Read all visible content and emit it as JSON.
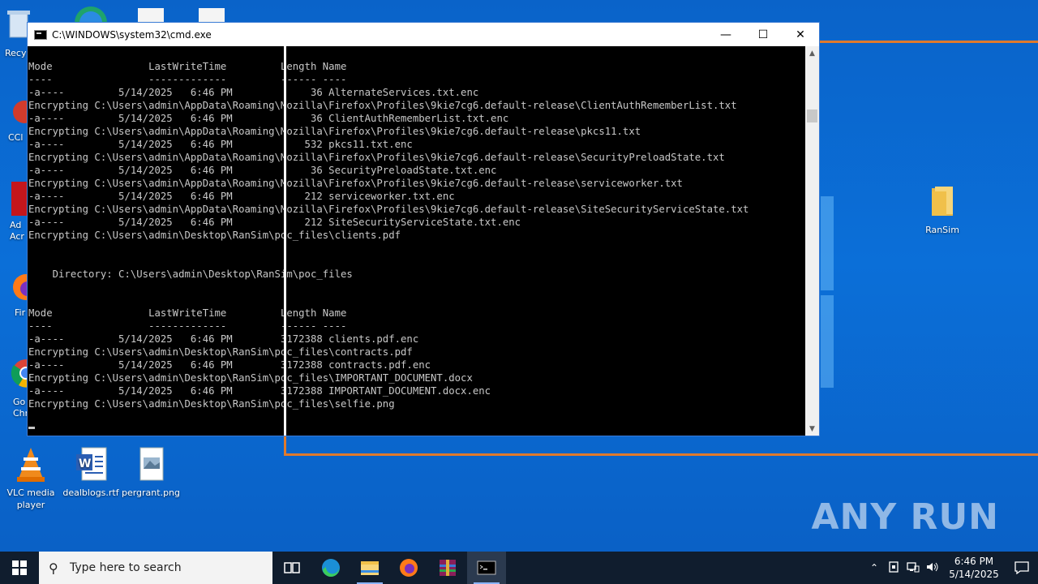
{
  "window": {
    "title": "C:\\WINDOWS\\system32\\cmd.exe",
    "minimize": "—",
    "maximize": "☐",
    "close": "✕"
  },
  "console_lines": [
    "",
    "Mode                LastWriteTime         Length Name",
    "----                -------------         ------ ----",
    "-a----         5/14/2025   6:46 PM             36 AlternateServices.txt.enc",
    "Encrypting C:\\Users\\admin\\AppData\\Roaming\\Mozilla\\Firefox\\Profiles\\9kie7cg6.default-release\\ClientAuthRememberList.txt",
    "-a----         5/14/2025   6:46 PM             36 ClientAuthRememberList.txt.enc",
    "Encrypting C:\\Users\\admin\\AppData\\Roaming\\Mozilla\\Firefox\\Profiles\\9kie7cg6.default-release\\pkcs11.txt",
    "-a----         5/14/2025   6:46 PM            532 pkcs11.txt.enc",
    "Encrypting C:\\Users\\admin\\AppData\\Roaming\\Mozilla\\Firefox\\Profiles\\9kie7cg6.default-release\\SecurityPreloadState.txt",
    "-a----         5/14/2025   6:46 PM             36 SecurityPreloadState.txt.enc",
    "Encrypting C:\\Users\\admin\\AppData\\Roaming\\Mozilla\\Firefox\\Profiles\\9kie7cg6.default-release\\serviceworker.txt",
    "-a----         5/14/2025   6:46 PM            212 serviceworker.txt.enc",
    "Encrypting C:\\Users\\admin\\AppData\\Roaming\\Mozilla\\Firefox\\Profiles\\9kie7cg6.default-release\\SiteSecurityServiceState.txt",
    "-a----         5/14/2025   6:46 PM            212 SiteSecurityServiceState.txt.enc",
    "Encrypting C:\\Users\\admin\\Desktop\\RanSim\\poc_files\\clients.pdf",
    "",
    "",
    "    Directory: C:\\Users\\admin\\Desktop\\RanSim\\poc_files",
    "",
    "",
    "Mode                LastWriteTime         Length Name",
    "----                -------------         ------ ----",
    "-a----         5/14/2025   6:46 PM        3172388 clients.pdf.enc",
    "Encrypting C:\\Users\\admin\\Desktop\\RanSim\\poc_files\\contracts.pdf",
    "-a----         5/14/2025   6:46 PM        3172388 contracts.pdf.enc",
    "Encrypting C:\\Users\\admin\\Desktop\\RanSim\\poc_files\\IMPORTANT_DOCUMENT.docx",
    "-a----         5/14/2025   6:46 PM        3172388 IMPORTANT_DOCUMENT.docx.enc",
    "Encrypting C:\\Users\\admin\\Desktop\\RanSim\\poc_files\\selfie.png",
    ""
  ],
  "desktop": {
    "icons_left": [
      {
        "label": "Recy",
        "name": "recycle-bin"
      },
      {
        "label": "CCl",
        "name": "ccleaner"
      },
      {
        "label": "Ad Acr",
        "name": "adobe-acrobat"
      },
      {
        "label": "Fir",
        "name": "firefox"
      },
      {
        "label": "Go Chr",
        "name": "google-chrome"
      }
    ],
    "vlc": "VLC media player",
    "dealblogs": "dealblogs.rtf",
    "pergrant": "pergrant.png",
    "ransim": "RanSim"
  },
  "watermark": "ANY RUN",
  "taskbar": {
    "search_placeholder": "Type here to search",
    "time": "6:46 PM",
    "date": "5/14/2025"
  },
  "colors": {
    "accent_orange": "#e07a2c",
    "desktop_blue": "#0b6fd8",
    "taskbar": "#101d2e"
  }
}
